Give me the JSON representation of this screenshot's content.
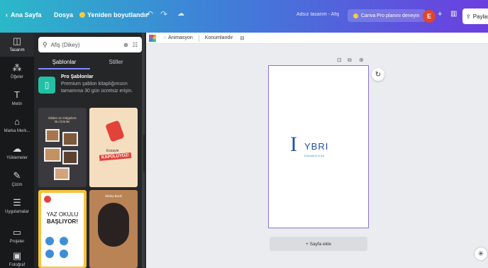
{
  "topbar": {
    "home": "Ana Sayfa",
    "file": "Dosya",
    "resize": "Yeniden boyutlandır",
    "undo_icon": "undo-icon",
    "redo_icon": "redo-icon",
    "cloud_icon": "cloud-icon",
    "design_title": "Adsız tasarım - Afiş",
    "canva_pro_cta": "Canva Pro planını deneyin",
    "avatar_initial": "E",
    "share": "Paylaş"
  },
  "rail": {
    "items": [
      {
        "label": "Tasarım",
        "icon": "layout-icon"
      },
      {
        "label": "Öğeler",
        "icon": "elements-icon"
      },
      {
        "label": "Metin",
        "icon": "text-icon"
      },
      {
        "label": "Marka Merk...",
        "icon": "brand-icon"
      },
      {
        "label": "Yüklemeler",
        "icon": "upload-icon"
      },
      {
        "label": "Çizim",
        "icon": "draw-icon"
      },
      {
        "label": "Uygulamalar",
        "icon": "apps-icon"
      },
      {
        "label": "Projeler",
        "icon": "folder-icon"
      },
      {
        "label": "Fotoğraf",
        "icon": "photo-icon"
      }
    ]
  },
  "panel": {
    "search_value": "Afiş (Dikey)",
    "tabs": [
      "Şablonlar",
      "Stiller"
    ],
    "pro_title": "Pro Şablonlar",
    "pro_desc_1": "Premium şablon kitaplığımızın",
    "pro_desc_2": "tamamına 30 gün ücretsiz erişin.",
    "templates": [
      {
        "t1": "Dilden ve Gölgelere",
        "t2": "Bu Ürünler"
      },
      {
        "t1": "Essayie",
        "t2": "KAPÜLÜYÜZ!"
      },
      {
        "t1": "YAZ OKULU",
        "t2": "BAŞLIYOR!"
      },
      {
        "t1": "Slidey Book"
      }
    ]
  },
  "toolbar": {
    "animate": "Animasyon",
    "position": "Konumlandır"
  },
  "page": {
    "logo_main": "YBRI",
    "logo_sub": "Education in Art",
    "add_page": "+ Sayfa ekle"
  },
  "colors": {
    "accent": "#8b6fe0",
    "pro_green": "#22c0a4",
    "avatar": "#e0452a",
    "logo_blue": "#1f4fa8"
  }
}
